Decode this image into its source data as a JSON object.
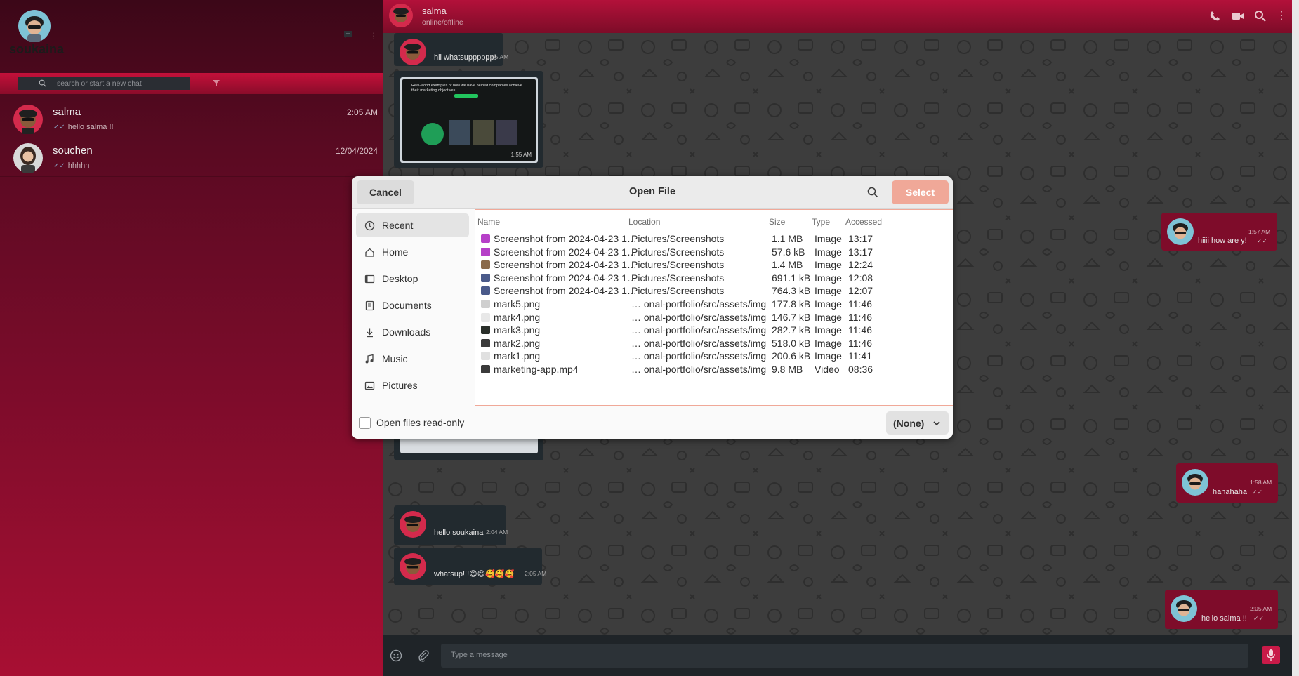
{
  "sidebar": {
    "user_name": "soukaina",
    "search_placeholder": "search or start a new chat",
    "chats": [
      {
        "name": "salma",
        "last_message": "hello salma !!",
        "time": "2:05 AM"
      },
      {
        "name": "souchen",
        "last_message": "hhhhh",
        "time": "12/04/2024"
      }
    ]
  },
  "chat": {
    "contact_name": "salma",
    "contact_status": "online/offline",
    "composer_placeholder": "Type a message",
    "messages": [
      {
        "text": "hii whatsupppppp!",
        "time": "1:55 AM"
      },
      {
        "text": "",
        "time": "1:55 AM"
      },
      {
        "text": "hiiii how are y!",
        "time": "1:57 AM"
      },
      {
        "text": "hahahaha",
        "time": "1:58 AM"
      },
      {
        "text": "hello soukaina",
        "time": "2:04 AM"
      },
      {
        "text": "whatsup!!!😄😄🥰🥰🥰",
        "time": "2:05 AM"
      },
      {
        "text": "hello salma !!",
        "time": "2:05 AM"
      }
    ],
    "image_message": {
      "headline": "Real-world examples of how we have helped companies achieve their marketing objectives."
    }
  },
  "dialog": {
    "cancel_label": "Cancel",
    "title": "Open File",
    "select_label": "Select",
    "places": [
      "Recent",
      "Home",
      "Desktop",
      "Documents",
      "Downloads",
      "Music",
      "Pictures"
    ],
    "columns": {
      "name": "Name",
      "location": "Location",
      "size": "Size",
      "type": "Type",
      "accessed": "Accessed"
    },
    "files": [
      {
        "name": "Screenshot from 2024-04-23 1…",
        "location": "Pictures/Screenshots",
        "size": "1.1 MB",
        "type": "Image",
        "accessed": "13:17",
        "icon": "image-icon",
        "color": "#b640c8"
      },
      {
        "name": "Screenshot from 2024-04-23 1…",
        "location": "Pictures/Screenshots",
        "size": "57.6 kB",
        "type": "Image",
        "accessed": "13:17",
        "icon": "image-icon",
        "color": "#b640c8"
      },
      {
        "name": "Screenshot from 2024-04-23 1…",
        "location": "Pictures/Screenshots",
        "size": "1.4 MB",
        "type": "Image",
        "accessed": "12:24",
        "icon": "image-thumb-icon",
        "color": "#8a6a4a"
      },
      {
        "name": "Screenshot from 2024-04-23 1…",
        "location": "Pictures/Screenshots",
        "size": "691.1 kB",
        "type": "Image",
        "accessed": "12:08",
        "icon": "image-thumb-icon",
        "color": "#4a5a8a"
      },
      {
        "name": "Screenshot from 2024-04-23 1…",
        "location": "Pictures/Screenshots",
        "size": "764.3 kB",
        "type": "Image",
        "accessed": "12:07",
        "icon": "image-thumb-icon",
        "color": "#4a5a8a"
      },
      {
        "name": "mark5.png",
        "location": "… onal-portfolio/src/assets/img",
        "size": "177.8 kB",
        "type": "Image",
        "accessed": "11:46",
        "icon": "image-thumb-icon",
        "color": "#cfcfcf"
      },
      {
        "name": "mark4.png",
        "location": "… onal-portfolio/src/assets/img",
        "size": "146.7 kB",
        "type": "Image",
        "accessed": "11:46",
        "icon": "image-thumb-icon",
        "color": "#e8e8e8"
      },
      {
        "name": "mark3.png",
        "location": "… onal-portfolio/src/assets/img",
        "size": "282.7 kB",
        "type": "Image",
        "accessed": "11:46",
        "icon": "image-thumb-icon",
        "color": "#2a2f2a"
      },
      {
        "name": "mark2.png",
        "location": "… onal-portfolio/src/assets/img",
        "size": "518.0 kB",
        "type": "Image",
        "accessed": "11:46",
        "icon": "image-thumb-icon",
        "color": "#3a3a3a"
      },
      {
        "name": "mark1.png",
        "location": "… onal-portfolio/src/assets/img",
        "size": "200.6 kB",
        "type": "Image",
        "accessed": "11:41",
        "icon": "image-thumb-icon",
        "color": "#e0e0e0"
      },
      {
        "name": "marketing-app.mp4",
        "location": "… onal-portfolio/src/assets/img",
        "size": "9.8 MB",
        "type": "Video",
        "accessed": "08:36",
        "icon": "video-icon",
        "color": "#3a3a3a"
      }
    ],
    "readonly_label": "Open files read-only",
    "filter_value": "(None)"
  },
  "colors": {
    "accent": "#b3113a",
    "select_button": "#f0a898",
    "bubble_in": "#222a2f",
    "bubble_out": "#7e0c2a"
  }
}
